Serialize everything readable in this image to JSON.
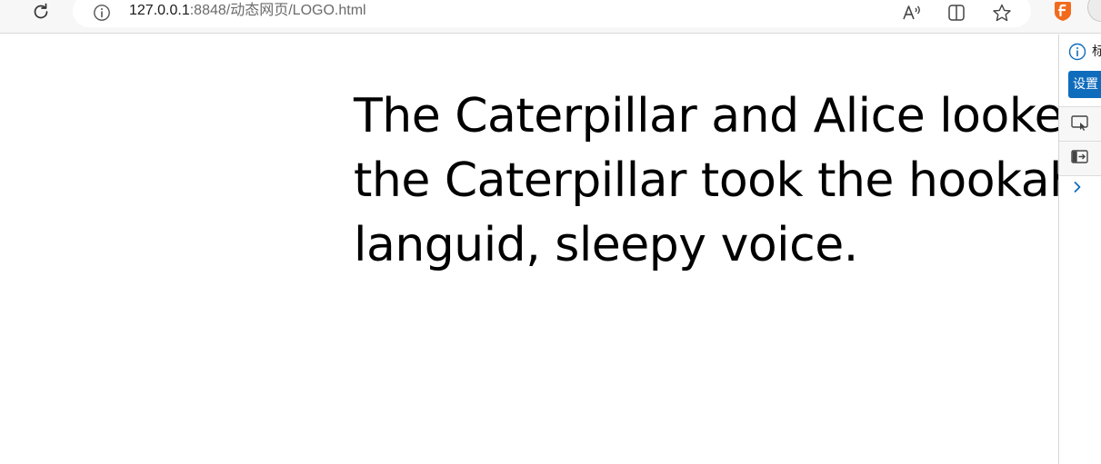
{
  "browser": {
    "url_host": "127.0.0.1",
    "url_path": ":8848/动态网页/LOGO.html",
    "icons": {
      "reload": "reload-icon",
      "site_info": "info-icon",
      "read_aloud": "read-aloud-icon",
      "split_screen": "split-screen-icon",
      "favorite": "star-icon",
      "extension": "extension-icon"
    }
  },
  "page": {
    "lines": [
      "The Caterpillar and Alice looked",
      "the Caterpillar took the hookah",
      "languid, sleepy voice."
    ]
  },
  "side_panel": {
    "truncated_text": "标",
    "button_label": "设置",
    "icons": [
      "info-icon",
      "cast-icon",
      "exit-panel-icon",
      "chevron-right-icon"
    ],
    "accent_color": "#0f6cbd"
  }
}
